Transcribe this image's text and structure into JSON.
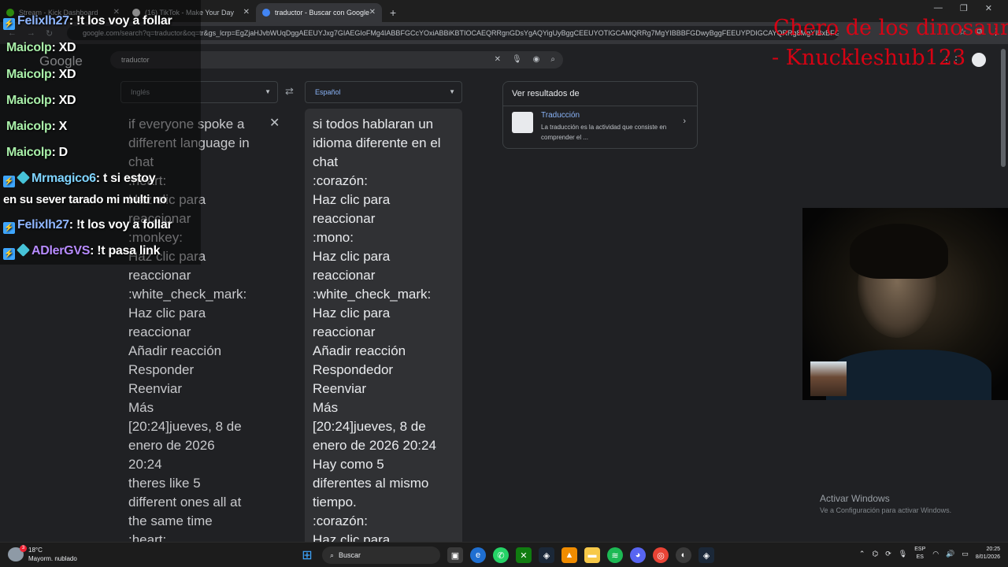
{
  "browser": {
    "tabs": [
      {
        "title": "Stream - Kick Dashboard",
        "icon": "kick-icon",
        "color": "#53fc18"
      },
      {
        "title": "(16) TikTok - Make Your Day",
        "icon": "tiktok-icon",
        "color": "#ffffff"
      },
      {
        "title": "traductor - Buscar con Google",
        "icon": "google-icon",
        "color": "#4285f4",
        "active": true
      }
    ],
    "url": "google.com/search?q=traductor&oq=tr&gs_lcrp=EgZjaHJvbWUqDggAEEUYJxg7GIAEGIoFMg4IABBFGCcYOxiABBiKBTIOCAEQRRgnGDsYgAQYigUyBggCEEUYOTIGCAMQRRg7MgYIBBBFGDwyBggFEEUYPDIGCAYQRRg8MgYIBxBFGDzSAQg..."
  },
  "search": {
    "logo": "Google",
    "query": "traductor"
  },
  "translator": {
    "source_lang": "Inglés",
    "target_lang": "Español",
    "source_text": "if everyone spoke a\ndifferent language in\nchat\n:heart:\nHaz clic para\nreaccionar\n:monkey:\nHaz clic para\nreaccionar\n:white_check_mark:\nHaz clic para\nreaccionar\nAñadir reacción\nResponder\nReenviar\nMás\n[20:24]jueves, 8 de\nenero de 2026\n20:24\ntheres like 5\ndifferent ones all at\nthe same time\n:heart:",
    "target_text": "si todos hablaran un\nidioma diferente en el\nchat\n:corazón:\nHaz clic para\nreaccionar\n:mono:\nHaz clic para\nreaccionar\n:white_check_mark:\nHaz clic para\nreaccionar\nAñadir reacción\nRespondedor\nReenviar\nMás\n[20:24]jueves, 8 de\nenero de 2026 20:24\nHay como 5\ndiferentes al mismo\ntiempo.\n:corazón:\nHaz clic para"
  },
  "results_panel": {
    "heading": "Ver resultados de",
    "item_title": "Traducción",
    "item_desc": "La traducción es la actividad que consiste en comprender el ..."
  },
  "watermark": {
    "line1": "Activar Windows",
    "line2": "Ve a Configuración para activar Windows."
  },
  "overlay": {
    "title_line1": "Chero de los dinosaurs",
    "title_line2": "- Knuckleshub123"
  },
  "chat": {
    "messages": [
      {
        "user": "Felixlh27",
        "text": ": !t los voy a follar"
      },
      {
        "user": "Maicolp",
        "text": ": XD"
      },
      {
        "user": "Maicolp",
        "text": ": XD"
      },
      {
        "user": "Maicolp",
        "text": ": XD"
      },
      {
        "user": "Maicolp",
        "text": ": X"
      },
      {
        "user": "Maicolp",
        "text": ": D"
      },
      {
        "user": "Mrmagico6",
        "text": ": t si estoy"
      },
      {
        "user": "",
        "text": "en su sever tarado mi multi no"
      },
      {
        "user": "Felixlh27",
        "text": ": !t los voy a follar"
      },
      {
        "user": "ADlerGVS",
        "text": ": !t pasa link"
      }
    ]
  },
  "taskbar": {
    "weather_temp": "18°C",
    "weather_desc": "Mayorm. nublado",
    "weather_badge": "3",
    "search_label": "Buscar",
    "lang_top": "ESP",
    "lang_bottom": "ES",
    "time": "20:25",
    "date": "8/01/2026"
  }
}
